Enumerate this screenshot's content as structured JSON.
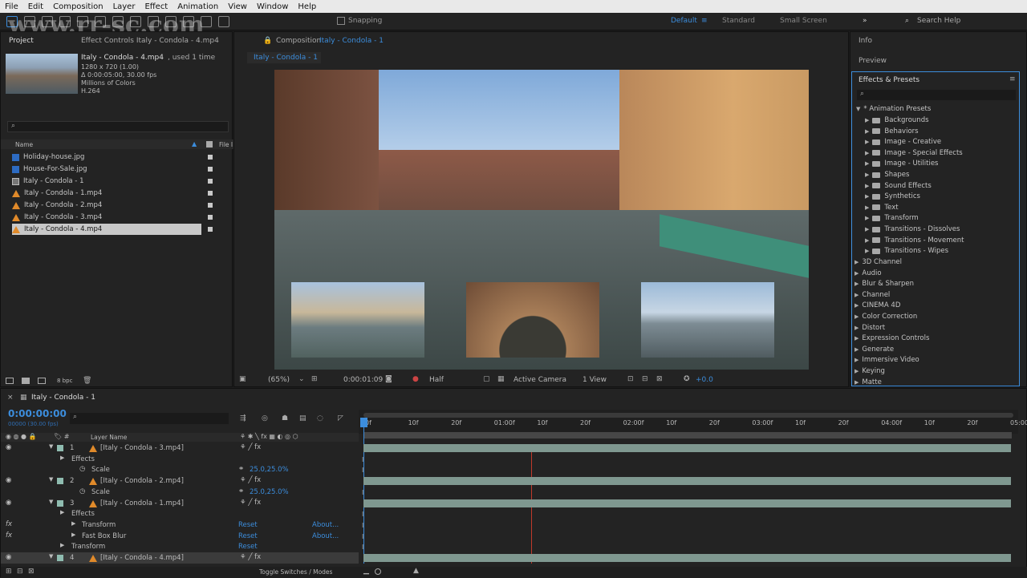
{
  "menu": [
    "File",
    "Edit",
    "Composition",
    "Layer",
    "Effect",
    "Animation",
    "View",
    "Window",
    "Help"
  ],
  "toolbar": {
    "snapping": "Snapping",
    "workspaces": [
      "Default",
      "Standard",
      "Small Screen"
    ],
    "search_help": "Search Help"
  },
  "watermark": "www.rr-sc.com",
  "project_panel": {
    "tab": "Project",
    "effect_controls_tab": "Effect Controls Italy - Condola - 4.mp4",
    "item_name": "Italy - Condola - 4.mp4",
    "used": ", used 1 time",
    "meta": [
      "1280 x 720 (1.00)",
      "Δ 0:00:05:00, 30.00 fps",
      "Millions of Colors",
      "H.264"
    ],
    "column_name": "Name",
    "column_file": "File I",
    "files": [
      {
        "name": "Holiday-house.jpg",
        "type": "image"
      },
      {
        "name": "House-For-Sale.jpg",
        "type": "image"
      },
      {
        "name": "Italy - Condola - 1",
        "type": "comp"
      },
      {
        "name": "Italy - Condola - 1.mp4",
        "type": "video"
      },
      {
        "name": "Italy - Condola - 2.mp4",
        "type": "video"
      },
      {
        "name": "Italy - Condola - 3.mp4",
        "type": "video"
      },
      {
        "name": "Italy - Condola - 4.mp4",
        "type": "video"
      }
    ],
    "bpc": "8 bpc"
  },
  "composition_panel": {
    "tab_prefix": "Composition",
    "tab_name": "Italy - Condola - 1",
    "sub_tab": "Italy - Condola - 1",
    "zoom": "(65%)",
    "timecode": "0:00:01:09",
    "resolution": "Half",
    "camera": "Active Camera",
    "view": "1 View",
    "exposure": "+0.0"
  },
  "right_panel": {
    "info": "Info",
    "preview": "Preview",
    "effects_title": "Effects & Presets",
    "animation_presets": "* Animation Presets",
    "presets": [
      "Backgrounds",
      "Behaviors",
      "Image - Creative",
      "Image - Special Effects",
      "Image - Utilities",
      "Shapes",
      "Sound Effects",
      "Synthetics",
      "Text",
      "Transform",
      "Transitions - Dissolves",
      "Transitions - Movement",
      "Transitions - Wipes"
    ],
    "categories": [
      "3D Channel",
      "Audio",
      "Blur & Sharpen",
      "Channel",
      "CINEMA 4D",
      "Color Correction",
      "Distort",
      "Expression Controls",
      "Generate",
      "Immersive Video",
      "Keying",
      "Matte"
    ]
  },
  "timeline": {
    "tab": "Italy - Condola - 1",
    "timecode": "0:00:00:00",
    "fps": "00000 (30.00 fps)",
    "layer_name_header": "Layer Name",
    "ruler": [
      "0f",
      "10f",
      "20f",
      "01:00f",
      "10f",
      "20f",
      "02:00f",
      "10f",
      "20f",
      "03:00f",
      "10f",
      "20f",
      "04:00f",
      "10f",
      "20f",
      "05:00"
    ],
    "rows": [
      {
        "num": "1",
        "name": "[Italy - Condola - 3.mp4]",
        "kind": "layer"
      },
      {
        "name": "Effects",
        "kind": "group"
      },
      {
        "name": "Scale",
        "value": "25.0,25.0%",
        "kind": "prop"
      },
      {
        "num": "2",
        "name": "[Italy - Condola - 2.mp4]",
        "kind": "layer"
      },
      {
        "name": "Scale",
        "value": "25.0,25.0%",
        "kind": "prop"
      },
      {
        "num": "3",
        "name": "[Italy - Condola - 1.mp4]",
        "kind": "layer"
      },
      {
        "name": "Effects",
        "kind": "group"
      },
      {
        "name": "Transform",
        "reset": "Reset",
        "about": "About...",
        "kind": "fx"
      },
      {
        "name": "Fast Box Blur",
        "reset": "Reset",
        "about": "About...",
        "kind": "fx"
      },
      {
        "name": "Transform",
        "reset": "Reset",
        "kind": "group"
      },
      {
        "num": "4",
        "name": "[Italy - Condola - 4.mp4]",
        "kind": "layer"
      }
    ],
    "toggle": "Toggle Switches / Modes"
  },
  "colors": {
    "accent": "#3c8ddc",
    "track": "#7f9890",
    "playhead": "#c0392b",
    "work_area": "#2f9e3a"
  }
}
